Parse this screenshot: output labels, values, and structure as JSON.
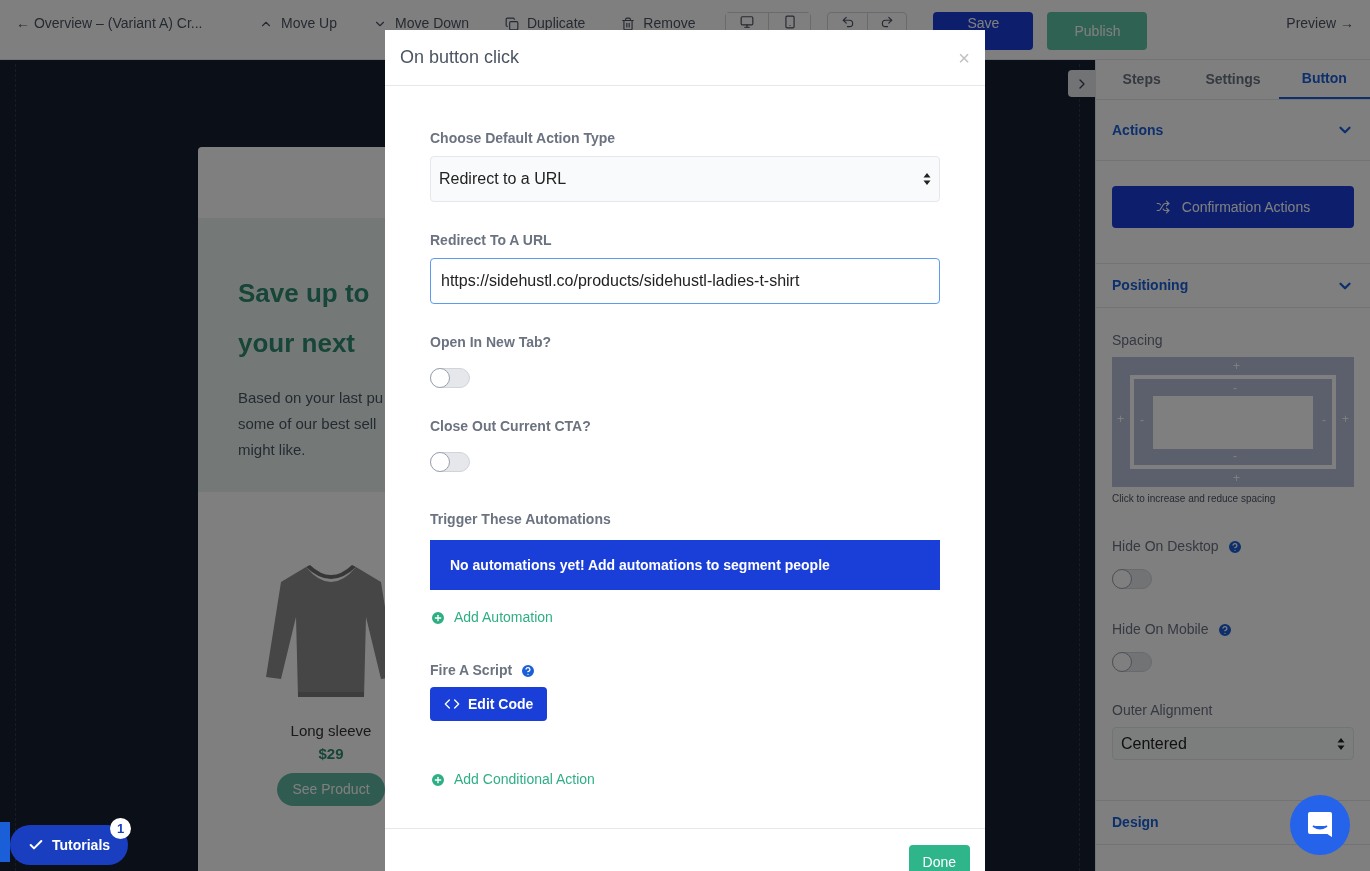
{
  "toolbar": {
    "back_link": "← Overview – (Variant A) Cr...",
    "actions": [
      {
        "label": "Move Up",
        "kind": "up"
      },
      {
        "label": "Move Down",
        "kind": "down"
      },
      {
        "label": "Duplicate",
        "kind": "copy"
      },
      {
        "label": "Remove",
        "kind": "trash"
      }
    ],
    "devices": [
      {
        "kind": "desktop",
        "selected": false
      },
      {
        "kind": "mobile",
        "selected": false
      }
    ],
    "save": "Save",
    "publish": "Publish",
    "preview": "Preview →"
  },
  "canvas": {
    "headline": [
      "Save up to",
      "your next"
    ],
    "body": [
      "Based on your last pu",
      "some of our best sell",
      "might like."
    ],
    "product": {
      "name": "Long sleeve",
      "price": "$29",
      "button": "See Product"
    }
  },
  "panel": {
    "tabs": [
      {
        "label": "Steps",
        "selected": false
      },
      {
        "label": "Settings",
        "selected": false
      },
      {
        "label": "Button",
        "selected": true
      }
    ],
    "actions": {
      "title": "Actions",
      "expanded": true,
      "button": "Confirmation Actions"
    },
    "positioning": {
      "title": "Positioning",
      "expanded": true
    },
    "spacing": {
      "label": "Spacing",
      "outer_marks": [
        "+",
        "+",
        "+",
        "+"
      ],
      "inner_marks": [
        "-",
        "-",
        "-",
        "-"
      ],
      "hint": "Click to increase and reduce spacing"
    },
    "toggles": [
      {
        "label": "Hide On Desktop",
        "on": false
      },
      {
        "label": "Hide On Mobile",
        "on": false
      }
    ],
    "alignment": {
      "label": "Outer Alignment",
      "value": "Centered"
    },
    "design": {
      "title": "Design"
    }
  },
  "modal": {
    "title": "On button click",
    "close": "×",
    "action_type": {
      "label": "Choose Default Action Type",
      "value": "Redirect to a URL"
    },
    "redirect": {
      "label": "Redirect To A URL",
      "value": "https://sidehustl.co/products/sidehustl-ladies-t-shirt"
    },
    "toggles": [
      {
        "label": "Open In New Tab?",
        "on": false
      },
      {
        "label": "Close Out Current CTA?",
        "on": false
      }
    ],
    "automations": {
      "label": "Trigger These Automations",
      "message": "No automations yet! Add automations to segment people",
      "add_link": "Add Automation"
    },
    "script": {
      "label": "Fire A Script",
      "button": "Edit Code"
    },
    "conditional_link": "Add Conditional Action",
    "done": "Done"
  },
  "tutorials": {
    "label": "Tutorials",
    "count": "1"
  }
}
